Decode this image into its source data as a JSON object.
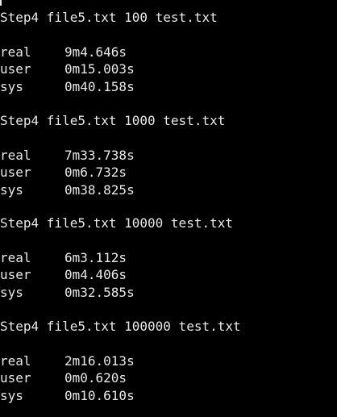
{
  "terminal": {
    "runs": [
      {
        "command": "Step4 file5.txt 100 test.txt",
        "real_label": "real",
        "real": "9m4.646s",
        "user_label": "user",
        "user": "0m15.003s",
        "sys_label": "sys",
        "sys": "0m40.158s"
      },
      {
        "command": "Step4 file5.txt 1000 test.txt",
        "real_label": "real",
        "real": "7m33.738s",
        "user_label": "user",
        "user": "0m6.732s",
        "sys_label": "sys",
        "sys": "0m38.825s"
      },
      {
        "command": "Step4 file5.txt 10000 test.txt",
        "real_label": "real",
        "real": "6m3.112s",
        "user_label": "user",
        "user": "0m4.406s",
        "sys_label": "sys",
        "sys": "0m32.585s"
      },
      {
        "command": "Step4 file5.txt 100000 test.txt",
        "real_label": "real",
        "real": "2m16.013s",
        "user_label": "user",
        "user": "0m0.620s",
        "sys_label": "sys",
        "sys": "0m10.610s"
      }
    ]
  },
  "colors": {
    "background": "#000000",
    "text": "#e8e8e8"
  }
}
